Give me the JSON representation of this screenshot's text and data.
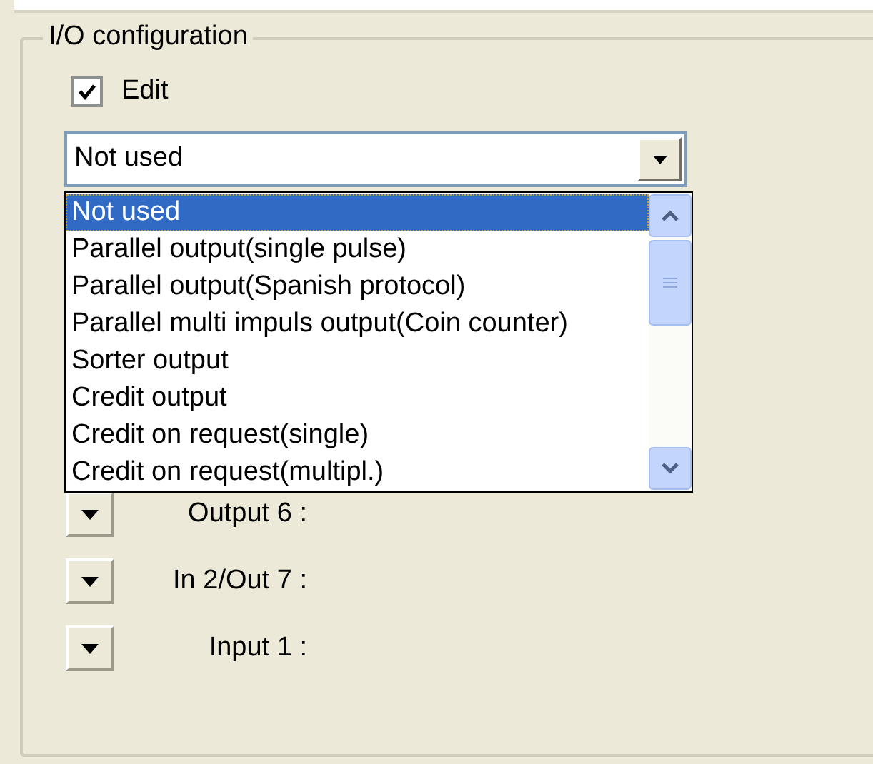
{
  "group": {
    "title": "I/O configuration"
  },
  "edit": {
    "label": "Edit",
    "checked": true
  },
  "combo": {
    "value": "Not used",
    "expanded": true
  },
  "options": [
    {
      "label": "Not used",
      "selected": true
    },
    {
      "label": "Parallel output(single pulse)",
      "selected": false
    },
    {
      "label": "Parallel output(Spanish protocol)",
      "selected": false
    },
    {
      "label": "Parallel multi impuls output(Coin counter)",
      "selected": false
    },
    {
      "label": "Sorter output",
      "selected": false
    },
    {
      "label": "Credit output",
      "selected": false
    },
    {
      "label": "Credit on request(single)",
      "selected": false
    },
    {
      "label": "Credit on request(multipl.)",
      "selected": false
    }
  ],
  "rows": [
    {
      "label": "Output 6 :"
    },
    {
      "label": "In 2/Out 7 :"
    },
    {
      "label": "Input 1 :"
    }
  ]
}
